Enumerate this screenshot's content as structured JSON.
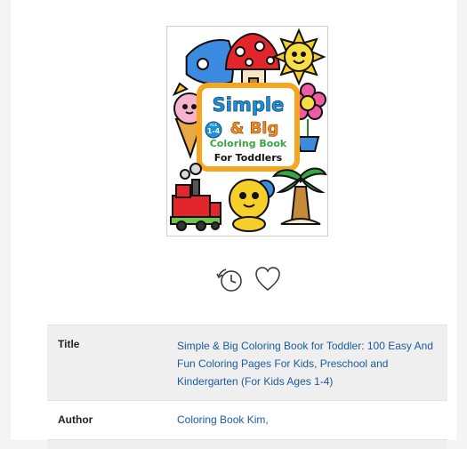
{
  "cover": {
    "line1": "Simple",
    "line2": "& Big",
    "age_top": "AGE",
    "age_range": "1-4",
    "line3": "Coloring Book",
    "line4": "For Toddlers"
  },
  "actions": [
    {
      "icon": "history-clock-icon"
    },
    {
      "icon": "heart-icon"
    }
  ],
  "details": {
    "title_label": "Title",
    "title_value": "Simple & Big Coloring Book for Toddler: 100 Easy And Fun Coloring Pages For Kids, Preschool and Kindergarten (For Kids Ages 1-4)",
    "author_label": "Author",
    "author_value": "Coloring Book Kim,"
  },
  "colors": {
    "link": "#1a5b9e",
    "shaded_row": "#efefef",
    "frame_orange": "#f7a51c",
    "title_blue": "#1e90d8",
    "title_orange": "#f28c1e",
    "title_green": "#35a845"
  }
}
